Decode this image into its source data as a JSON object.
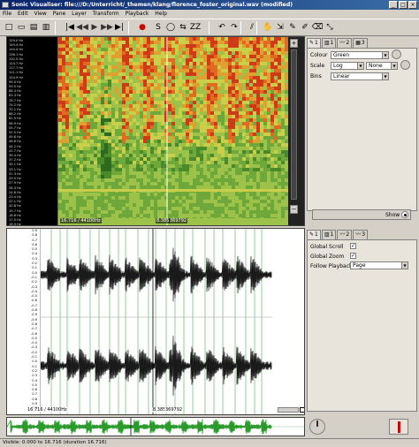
{
  "window": {
    "title": "Sonic Visualiser: file:///D:/Unterricht/_themen/klang/florence_foster_original.wav (modified)",
    "min_label": "_",
    "max_label": "□",
    "close_label": "×"
  },
  "menu": [
    "File",
    "Edit",
    "View",
    "Pane",
    "Layer",
    "Transform",
    "Playback",
    "Help"
  ],
  "toolbar": {
    "icons": [
      "new-file-icon",
      "open-icon",
      "save-icon",
      "save-as-icon",
      "rewind-start-icon",
      "rewind-icon",
      "play-icon",
      "fast-forward-icon",
      "forward-end-icon",
      "record-icon",
      "play-selection-icon",
      "loop-icon",
      "follow-icon",
      "solo-icon",
      "undo-icon",
      "redo-icon",
      "alignment-icon",
      "navigate-tool-icon",
      "select-tool-icon",
      "edit-tool-icon",
      "draw-tool-icon",
      "erase-tool-icon",
      "measure-tool-icon"
    ],
    "glyphs": [
      "□",
      "▭",
      "▤",
      "▥",
      "|◀",
      "◀◀",
      "▶",
      "▶▶",
      "▶|",
      "●",
      "S",
      "◯",
      "⇆",
      "ZZ",
      "↶",
      "↷",
      "⫽",
      "✋",
      "⇲",
      "✎",
      "✐",
      "⌫",
      "⤡"
    ]
  },
  "spectrogram": {
    "scale": [
      "159.0 Hz",
      "149.4 Hz",
      "140.4 Hz",
      "136.1 Hz",
      "132.0 Hz",
      "124.7 Hz",
      "117.7 Hz",
      "111.1 Hz",
      "104.9 Hz",
      "99.0 Hz",
      "93.5 Hz",
      "88.3 Hz",
      "83.3 Hz",
      "78.7 Hz",
      "74.2 Hz",
      "70.1 Hz",
      "66.2 Hz",
      "62.5 Hz",
      "58.9 Hz",
      "55.7 Hz",
      "52.5 Hz",
      "49.6 Hz",
      "46.8 Hz",
      "44.2 Hz",
      "41.7 Hz",
      "39.4 Hz",
      "37.2 Hz",
      "35.1 Hz",
      "33.1 Hz",
      "31.3 Hz",
      "29.5 Hz",
      "27.9 Hz",
      "26.3 Hz",
      "24.8 Hz",
      "23.4 Hz",
      "22.1 Hz",
      "20.8 Hz",
      "19.7 Hz",
      "18.6 Hz",
      "17.5 Hz",
      "16.5 Hz"
    ],
    "duration_info": "16.716 / 44100Hz",
    "cursor_time": "8.385",
    "cursor_frame": "369792"
  },
  "layer_panel_top": {
    "tabs": [
      "1",
      "1",
      "2",
      "3"
    ],
    "colour_label": "Colour",
    "colour_value": "Green",
    "scale_label": "Scale",
    "scale_value": "Log",
    "scale_mode": "None",
    "bins_label": "Bins",
    "bins_value": "Linear",
    "show_label": "Show"
  },
  "waveform": {
    "scale": [
      "0.9",
      "0.8",
      "0.7",
      "0.6",
      "0.5",
      "0.4",
      "0.3",
      "0.2",
      "0.1",
      "0.0",
      "-0.1",
      "-0.2",
      "-0.3",
      "-0.4",
      "-0.5",
      "-0.6",
      "-0.7",
      "-0.8",
      "-0.9",
      "-0.9",
      "-0.8",
      "-0.7",
      "-0.6",
      "-0.5",
      "-0.4",
      "-0.3",
      "-0.2",
      "-0.1",
      "0.0",
      "0.1",
      "0.2",
      "0.3",
      "0.4",
      "0.5",
      "0.6",
      "0.7",
      "0.8",
      "0.9",
      "0.9"
    ],
    "duration_info": "16.716 / 44100Hz",
    "cursor_time": "8.385",
    "cursor_frame": "369792"
  },
  "layer_panel_bottom": {
    "tabs": [
      "1",
      "1",
      "2",
      "3"
    ],
    "global_scroll_label": "Global Scroll",
    "global_zoom_label": "Global Zoom",
    "follow_playback_label": "Follow Playback",
    "follow_playback_value": "Page"
  },
  "status": {
    "text": "Visible: 0.000 to 16.716 (duration 16.716)"
  },
  "colors": {
    "spectrogram_bg": "#3a7a2a",
    "waveform": "#1a1a1a",
    "cursor": "#ffffff",
    "overview_wave": "#2a9a2a",
    "beat_lines": "#4caf50"
  }
}
